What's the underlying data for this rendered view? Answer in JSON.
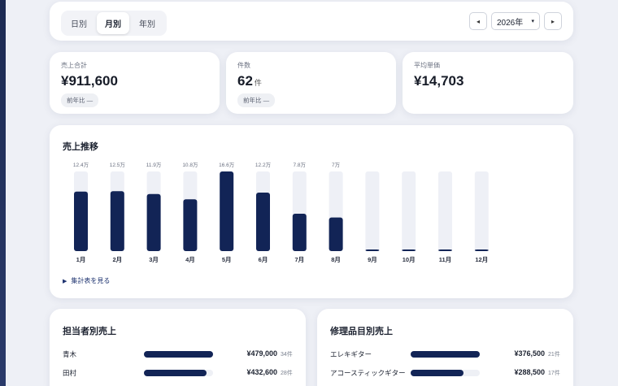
{
  "period_tabs": [
    {
      "label": "日別",
      "active": false
    },
    {
      "label": "月別",
      "active": true
    },
    {
      "label": "年別",
      "active": false
    }
  ],
  "year_nav": {
    "prev": "◂",
    "selected_year": "2026年",
    "next": "▸"
  },
  "kpis": [
    {
      "label": "売上合計",
      "value": "¥911,600",
      "unit": "",
      "badge": "前年比 —"
    },
    {
      "label": "件数",
      "value": "62",
      "unit": "件",
      "badge": "前年比 —"
    },
    {
      "label": "平均単価",
      "value": "¥14,703",
      "unit": "",
      "badge": ""
    }
  ],
  "chart_section": {
    "title": "売上推移",
    "toggle_label": "集計表を見る",
    "colors": {
      "bar": "#122456",
      "track": "#eef0f6"
    }
  },
  "chart_data": {
    "type": "bar",
    "categories": [
      "1月",
      "2月",
      "3月",
      "4月",
      "5月",
      "6月",
      "7月",
      "8月",
      "9月",
      "10月",
      "11月",
      "12月"
    ],
    "values": [
      12.4,
      12.5,
      11.9,
      10.8,
      16.6,
      12.2,
      7.8,
      7,
      0,
      0,
      0,
      0
    ],
    "data_labels": [
      "12.4万",
      "12.5万",
      "11.9万",
      "10.8万",
      "16.6万",
      "12.2万",
      "7.8万",
      "7万",
      "",
      "",
      "",
      ""
    ],
    "ylim": [
      0,
      16.6
    ],
    "grid": false
  },
  "staff_sales": {
    "title": "担当者別売上",
    "rows": [
      {
        "name": "青木",
        "amount": "¥479,000",
        "count": "34件",
        "share": 1.0
      },
      {
        "name": "田村",
        "amount": "¥432,600",
        "count": "28件",
        "share": 0.9
      }
    ]
  },
  "item_sales": {
    "title": "修理品目別売上",
    "rows": [
      {
        "name": "エレキギター",
        "amount": "¥376,500",
        "count": "21件",
        "share": 1.0
      },
      {
        "name": "アコースティックギター",
        "amount": "¥288,500",
        "count": "17件",
        "share": 0.77
      }
    ]
  }
}
